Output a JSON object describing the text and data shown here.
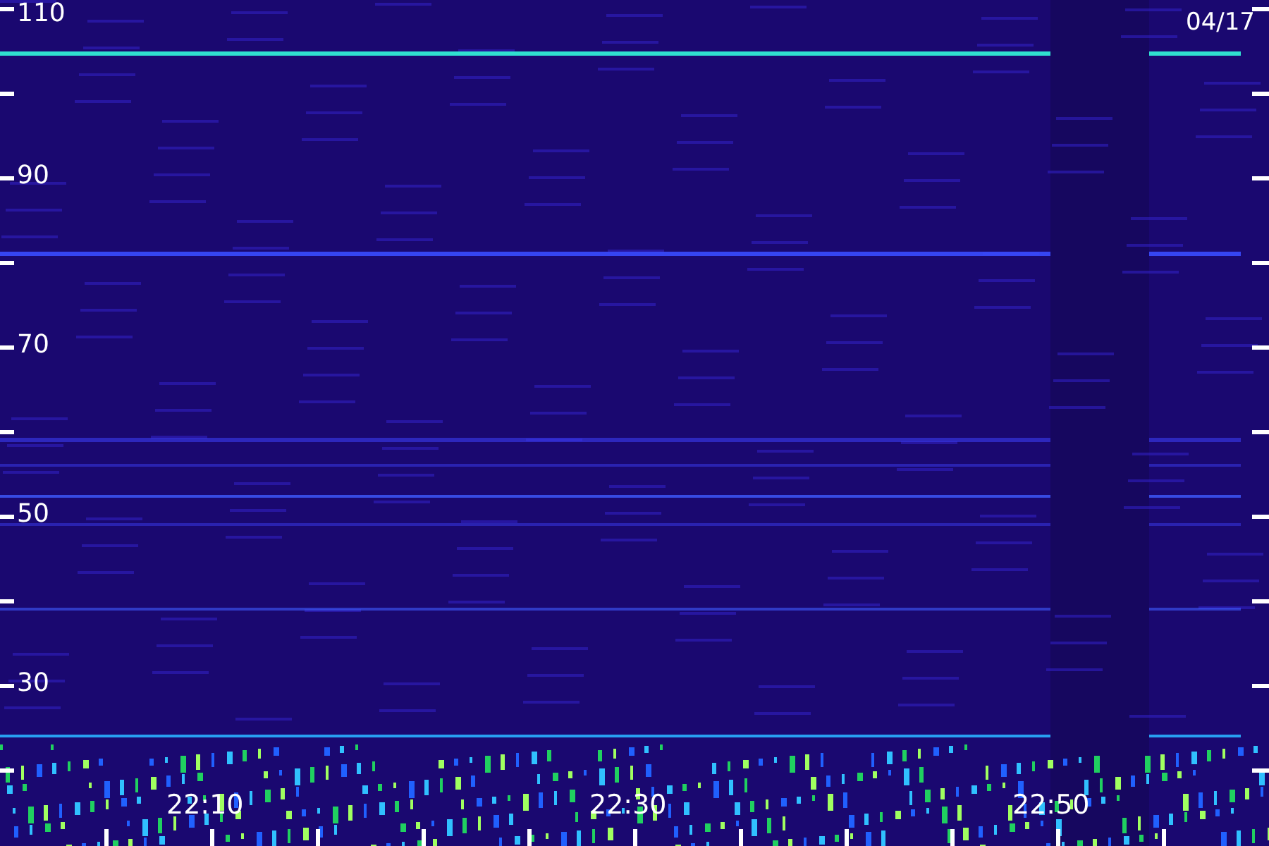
{
  "date": "04/17",
  "y_axis_labels": [
    "110",
    "90",
    "70",
    "50",
    "30"
  ],
  "time_labels": [
    "22:10",
    "22:30",
    "22:50"
  ]
}
